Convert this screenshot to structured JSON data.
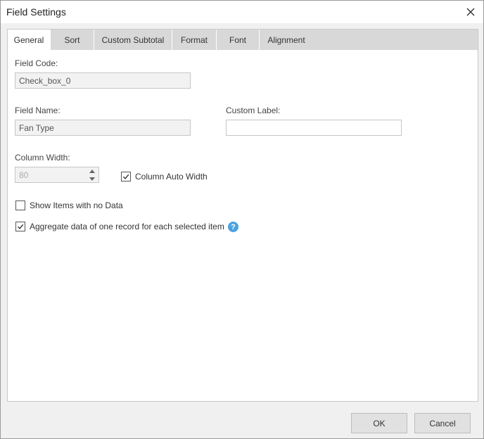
{
  "window": {
    "title": "Field Settings"
  },
  "tabs": [
    {
      "label": "General",
      "active": true
    },
    {
      "label": "Sort",
      "active": false
    },
    {
      "label": "Custom Subtotal",
      "active": false
    },
    {
      "label": "Format",
      "active": false
    },
    {
      "label": "Font",
      "active": false
    },
    {
      "label": "Alignment",
      "active": false
    }
  ],
  "general": {
    "field_code": {
      "label": "Field Code:",
      "value": "Check_box_0"
    },
    "field_name": {
      "label": "Field Name:",
      "value": "Fan Type"
    },
    "custom_label": {
      "label": "Custom Label:",
      "value": ""
    },
    "column_width": {
      "label": "Column Width:",
      "value": "80"
    },
    "column_auto_width": {
      "label": "Column Auto Width",
      "checked": true
    },
    "show_items_no_data": {
      "label": "Show Items with no Data",
      "checked": false
    },
    "aggregate_data": {
      "label": "Aggregate data of one record for each selected item",
      "checked": true
    },
    "help_glyph": "?"
  },
  "footer": {
    "ok_label": "OK",
    "cancel_label": "Cancel"
  },
  "colors": {
    "help_icon": "#4aa3df",
    "tab_strip": "#d8d8d8",
    "dialog_bg": "#f0f0f0"
  }
}
